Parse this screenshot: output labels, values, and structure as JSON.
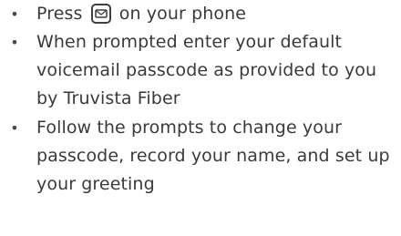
{
  "instructions": [
    {
      "bullet": "•",
      "before": "Press",
      "icon": "voicemail-envelope-icon",
      "after": "on your phone"
    },
    {
      "bullet": "•",
      "text": "When prompted enter your default voicemail passcode as provided to you by Truvista Fiber"
    },
    {
      "bullet": "•",
      "text": "Follow the prompts to change your passcode, record your name, and set up your greeting"
    }
  ]
}
